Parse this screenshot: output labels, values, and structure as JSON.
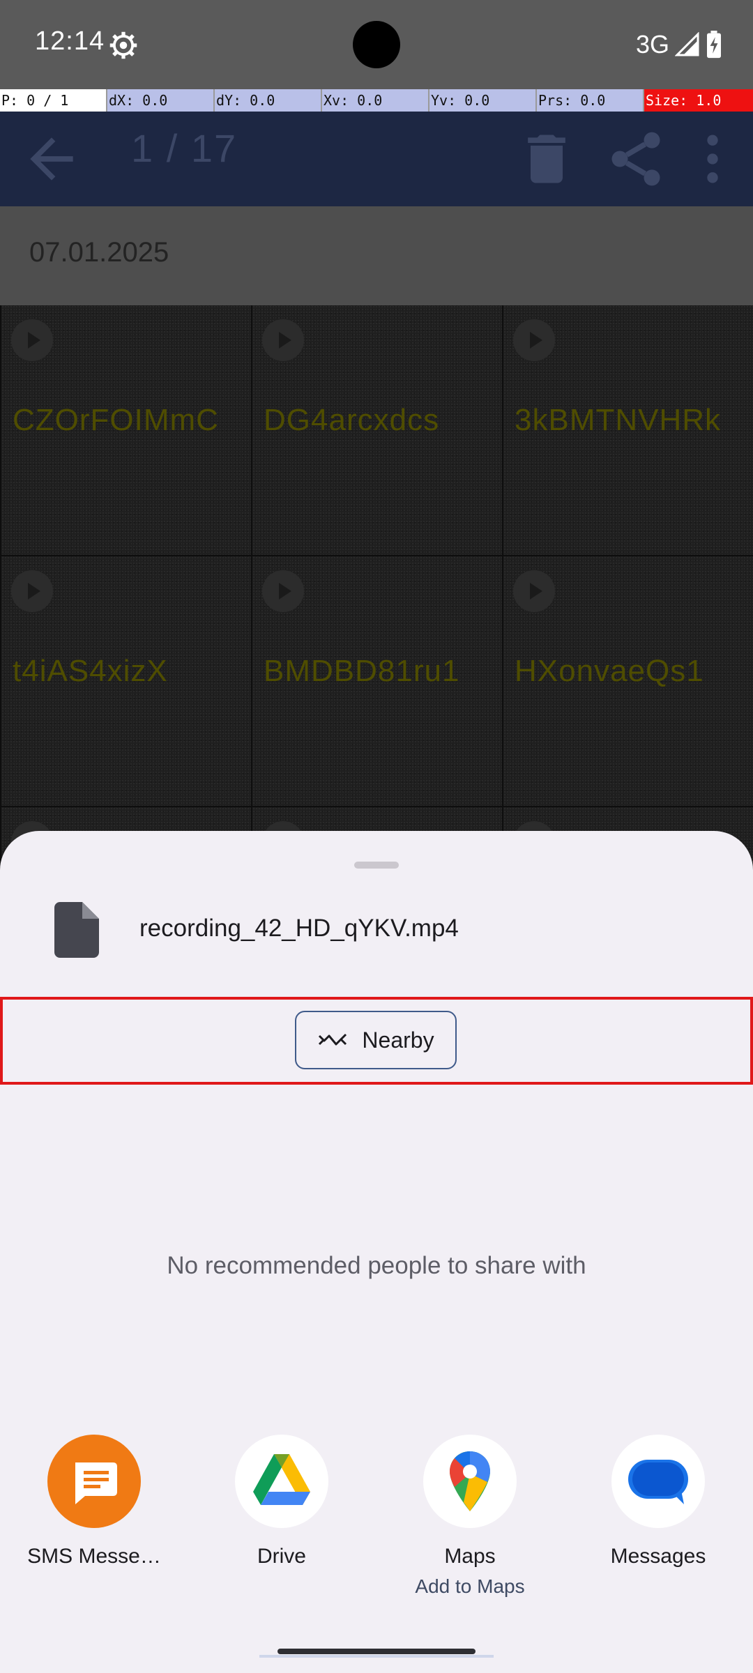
{
  "status_bar": {
    "time": "12:14",
    "network": "3G",
    "icons": [
      "settings-gear-icon",
      "signal-icon",
      "battery-charging-icon"
    ]
  },
  "pointer_overlay": {
    "cells": [
      "P: 0 / 1",
      "dX: 0.0",
      "dY: 0.0",
      "Xv: 0.0",
      "Yv: 0.0",
      "Prs: 0.0",
      "Size: 1.0"
    ]
  },
  "toolbar": {
    "counter": "1 / 17",
    "icons": [
      "back-arrow-icon",
      "delete-icon",
      "share-icon",
      "more-options-icon"
    ]
  },
  "date_header": "07.01.2025",
  "grid": {
    "items": [
      {
        "label": "CZOrFOIMmC"
      },
      {
        "label": "DG4arcxdcs"
      },
      {
        "label": "3kBMTNVHRk"
      },
      {
        "label": "t4iAS4xizX"
      },
      {
        "label": "BMDBD81ru1"
      },
      {
        "label": "HXonvaeQs1"
      }
    ]
  },
  "share_sheet": {
    "file_name": "recording_42_HD_qYKV.mp4",
    "nearby_label": "Nearby",
    "no_recommendations": "No recommended people to share with",
    "targets": [
      {
        "label": "SMS Messe…",
        "sub": "",
        "icon": "sms-messenger-icon"
      },
      {
        "label": "Drive",
        "sub": "",
        "icon": "google-drive-icon"
      },
      {
        "label": "Maps",
        "sub": "Add to Maps",
        "icon": "google-maps-icon"
      },
      {
        "label": "Messages",
        "sub": "",
        "icon": "google-messages-icon"
      }
    ]
  },
  "colors": {
    "sheet_bg": "#f2eff5",
    "highlight": "#e0181a",
    "sms_orange": "#f07a14",
    "toolbar_bg": "#1d2743"
  }
}
